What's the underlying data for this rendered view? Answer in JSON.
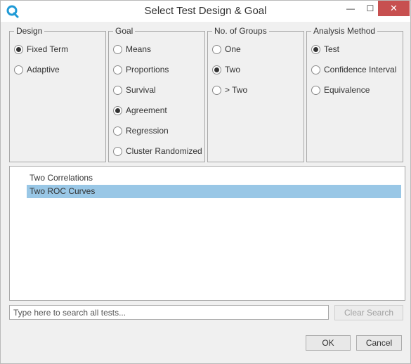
{
  "window": {
    "title": "Select Test Design & Goal",
    "icon": "app-logo-icon",
    "min_glyph": "—",
    "max_glyph": "☐",
    "close_glyph": "✕"
  },
  "groups": {
    "design": {
      "legend": "Design",
      "options": [
        {
          "label": "Fixed Term",
          "checked": true
        },
        {
          "label": "Adaptive",
          "checked": false
        }
      ]
    },
    "goal": {
      "legend": "Goal",
      "options": [
        {
          "label": "Means",
          "checked": false
        },
        {
          "label": "Proportions",
          "checked": false
        },
        {
          "label": "Survival",
          "checked": false
        },
        {
          "label": "Agreement",
          "checked": true
        },
        {
          "label": "Regression",
          "checked": false
        },
        {
          "label": "Cluster Randomized",
          "checked": false
        }
      ]
    },
    "groups": {
      "legend": "No. of Groups",
      "options": [
        {
          "label": "One",
          "checked": false
        },
        {
          "label": "Two",
          "checked": true
        },
        {
          "label": "> Two",
          "checked": false
        }
      ]
    },
    "method": {
      "legend": "Analysis Method",
      "options": [
        {
          "label": "Test",
          "checked": true
        },
        {
          "label": "Confidence Interval",
          "checked": false
        },
        {
          "label": "Equivalence",
          "checked": false
        }
      ]
    }
  },
  "tests": {
    "items": [
      {
        "label": "Two Correlations",
        "selected": false
      },
      {
        "label": "Two ROC Curves",
        "selected": true
      }
    ]
  },
  "search": {
    "placeholder": "Type here to search all tests...",
    "value": ""
  },
  "buttons": {
    "clear_search": "Clear Search",
    "ok": "OK",
    "cancel": "Cancel"
  },
  "colors": {
    "selection": "#99c7e6",
    "close_button": "#c75050",
    "logo": "#1f9ad6"
  }
}
